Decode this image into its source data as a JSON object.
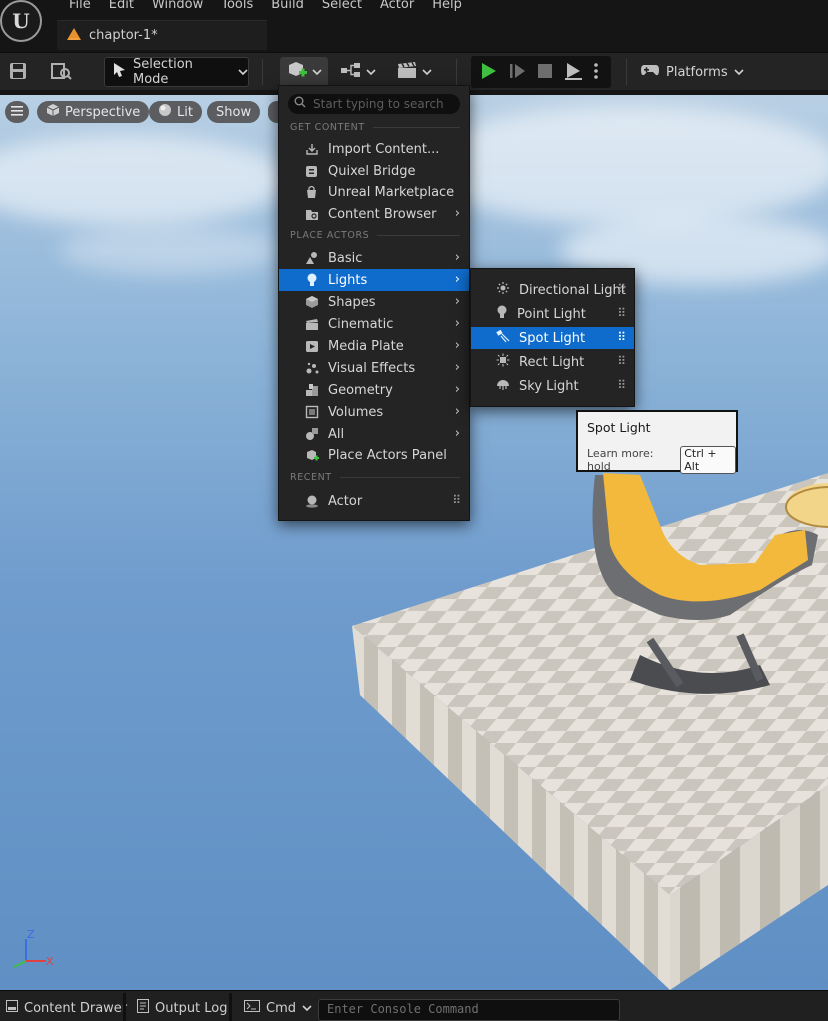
{
  "menubar": [
    "File",
    "Edit",
    "Window",
    "Tools",
    "Build",
    "Select",
    "Actor",
    "Help"
  ],
  "tab": {
    "label": "chaptor-1*"
  },
  "toolbar": {
    "selection_mode": "Selection Mode",
    "platforms": "Platforms"
  },
  "viewport": {
    "perspective": "Perspective",
    "lit": "Lit",
    "show": "Show",
    "axis_z": "Z",
    "axis_x": "X"
  },
  "menu": {
    "search_placeholder": "Start typing to search",
    "sections": {
      "get_content": "GET CONTENT",
      "place_actors": "PLACE ACTORS",
      "recent": "RECENT"
    },
    "get_content": [
      "Import Content...",
      "Quixel Bridge",
      "Unreal Marketplace",
      "Content Browser"
    ],
    "place_actors": [
      "Basic",
      "Lights",
      "Shapes",
      "Cinematic",
      "Media Plate",
      "Visual Effects",
      "Geometry",
      "Volumes",
      "All",
      "Place Actors Panel"
    ],
    "recent": [
      "Actor"
    ]
  },
  "submenu": {
    "items": [
      "Directional Light",
      "Point Light",
      "Spot Light",
      "Rect Light",
      "Sky Light"
    ]
  },
  "tooltip": {
    "title": "Spot Light",
    "learn_more": "Learn more: hold",
    "shortcut": "Ctrl + Alt"
  },
  "bottombar": {
    "content_drawer": "Content Drawer",
    "output_log": "Output Log",
    "cmd": "Cmd",
    "console_placeholder": "Enter Console Command"
  },
  "colors": {
    "highlight": "#0f6ccc",
    "play": "#3fbf3f"
  }
}
